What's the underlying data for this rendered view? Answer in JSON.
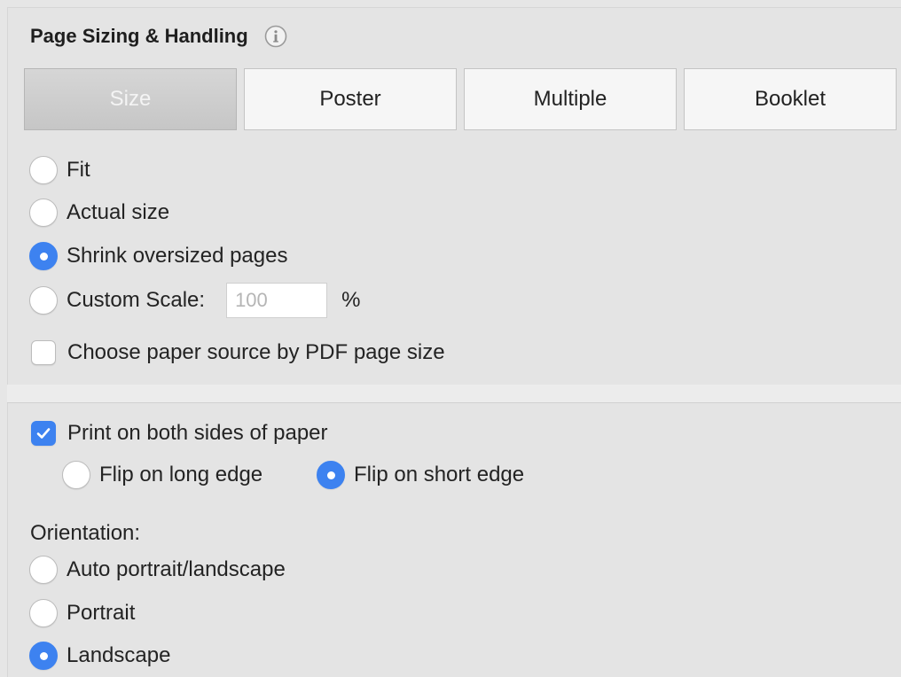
{
  "section": {
    "title": "Page Sizing & Handling",
    "info_icon": "info-icon"
  },
  "tabs": [
    {
      "label": "Size",
      "selected": true
    },
    {
      "label": "Poster",
      "selected": false
    },
    {
      "label": "Multiple",
      "selected": false
    },
    {
      "label": "Booklet",
      "selected": false
    }
  ],
  "sizing_options": [
    {
      "label": "Fit",
      "checked": false
    },
    {
      "label": "Actual size",
      "checked": false
    },
    {
      "label": "Shrink oversized pages",
      "checked": true
    },
    {
      "label": "Custom Scale:",
      "checked": false
    }
  ],
  "custom_scale": {
    "placeholder": "100",
    "unit": "%"
  },
  "paper_source": {
    "label": "Choose paper source by PDF page size",
    "checked": false
  },
  "duplex": {
    "label": "Print on both sides of paper",
    "checked": true,
    "options": [
      {
        "label": "Flip on long edge",
        "checked": false
      },
      {
        "label": "Flip on short edge",
        "checked": true
      }
    ]
  },
  "orientation": {
    "label": "Orientation:",
    "options": [
      {
        "label": "Auto portrait/landscape",
        "checked": false
      },
      {
        "label": "Portrait",
        "checked": false
      },
      {
        "label": "Landscape",
        "checked": true
      }
    ]
  },
  "colors": {
    "accent": "#3d82f0",
    "background": "#e4e4e4",
    "tab_selected": "#c6c6c6"
  }
}
